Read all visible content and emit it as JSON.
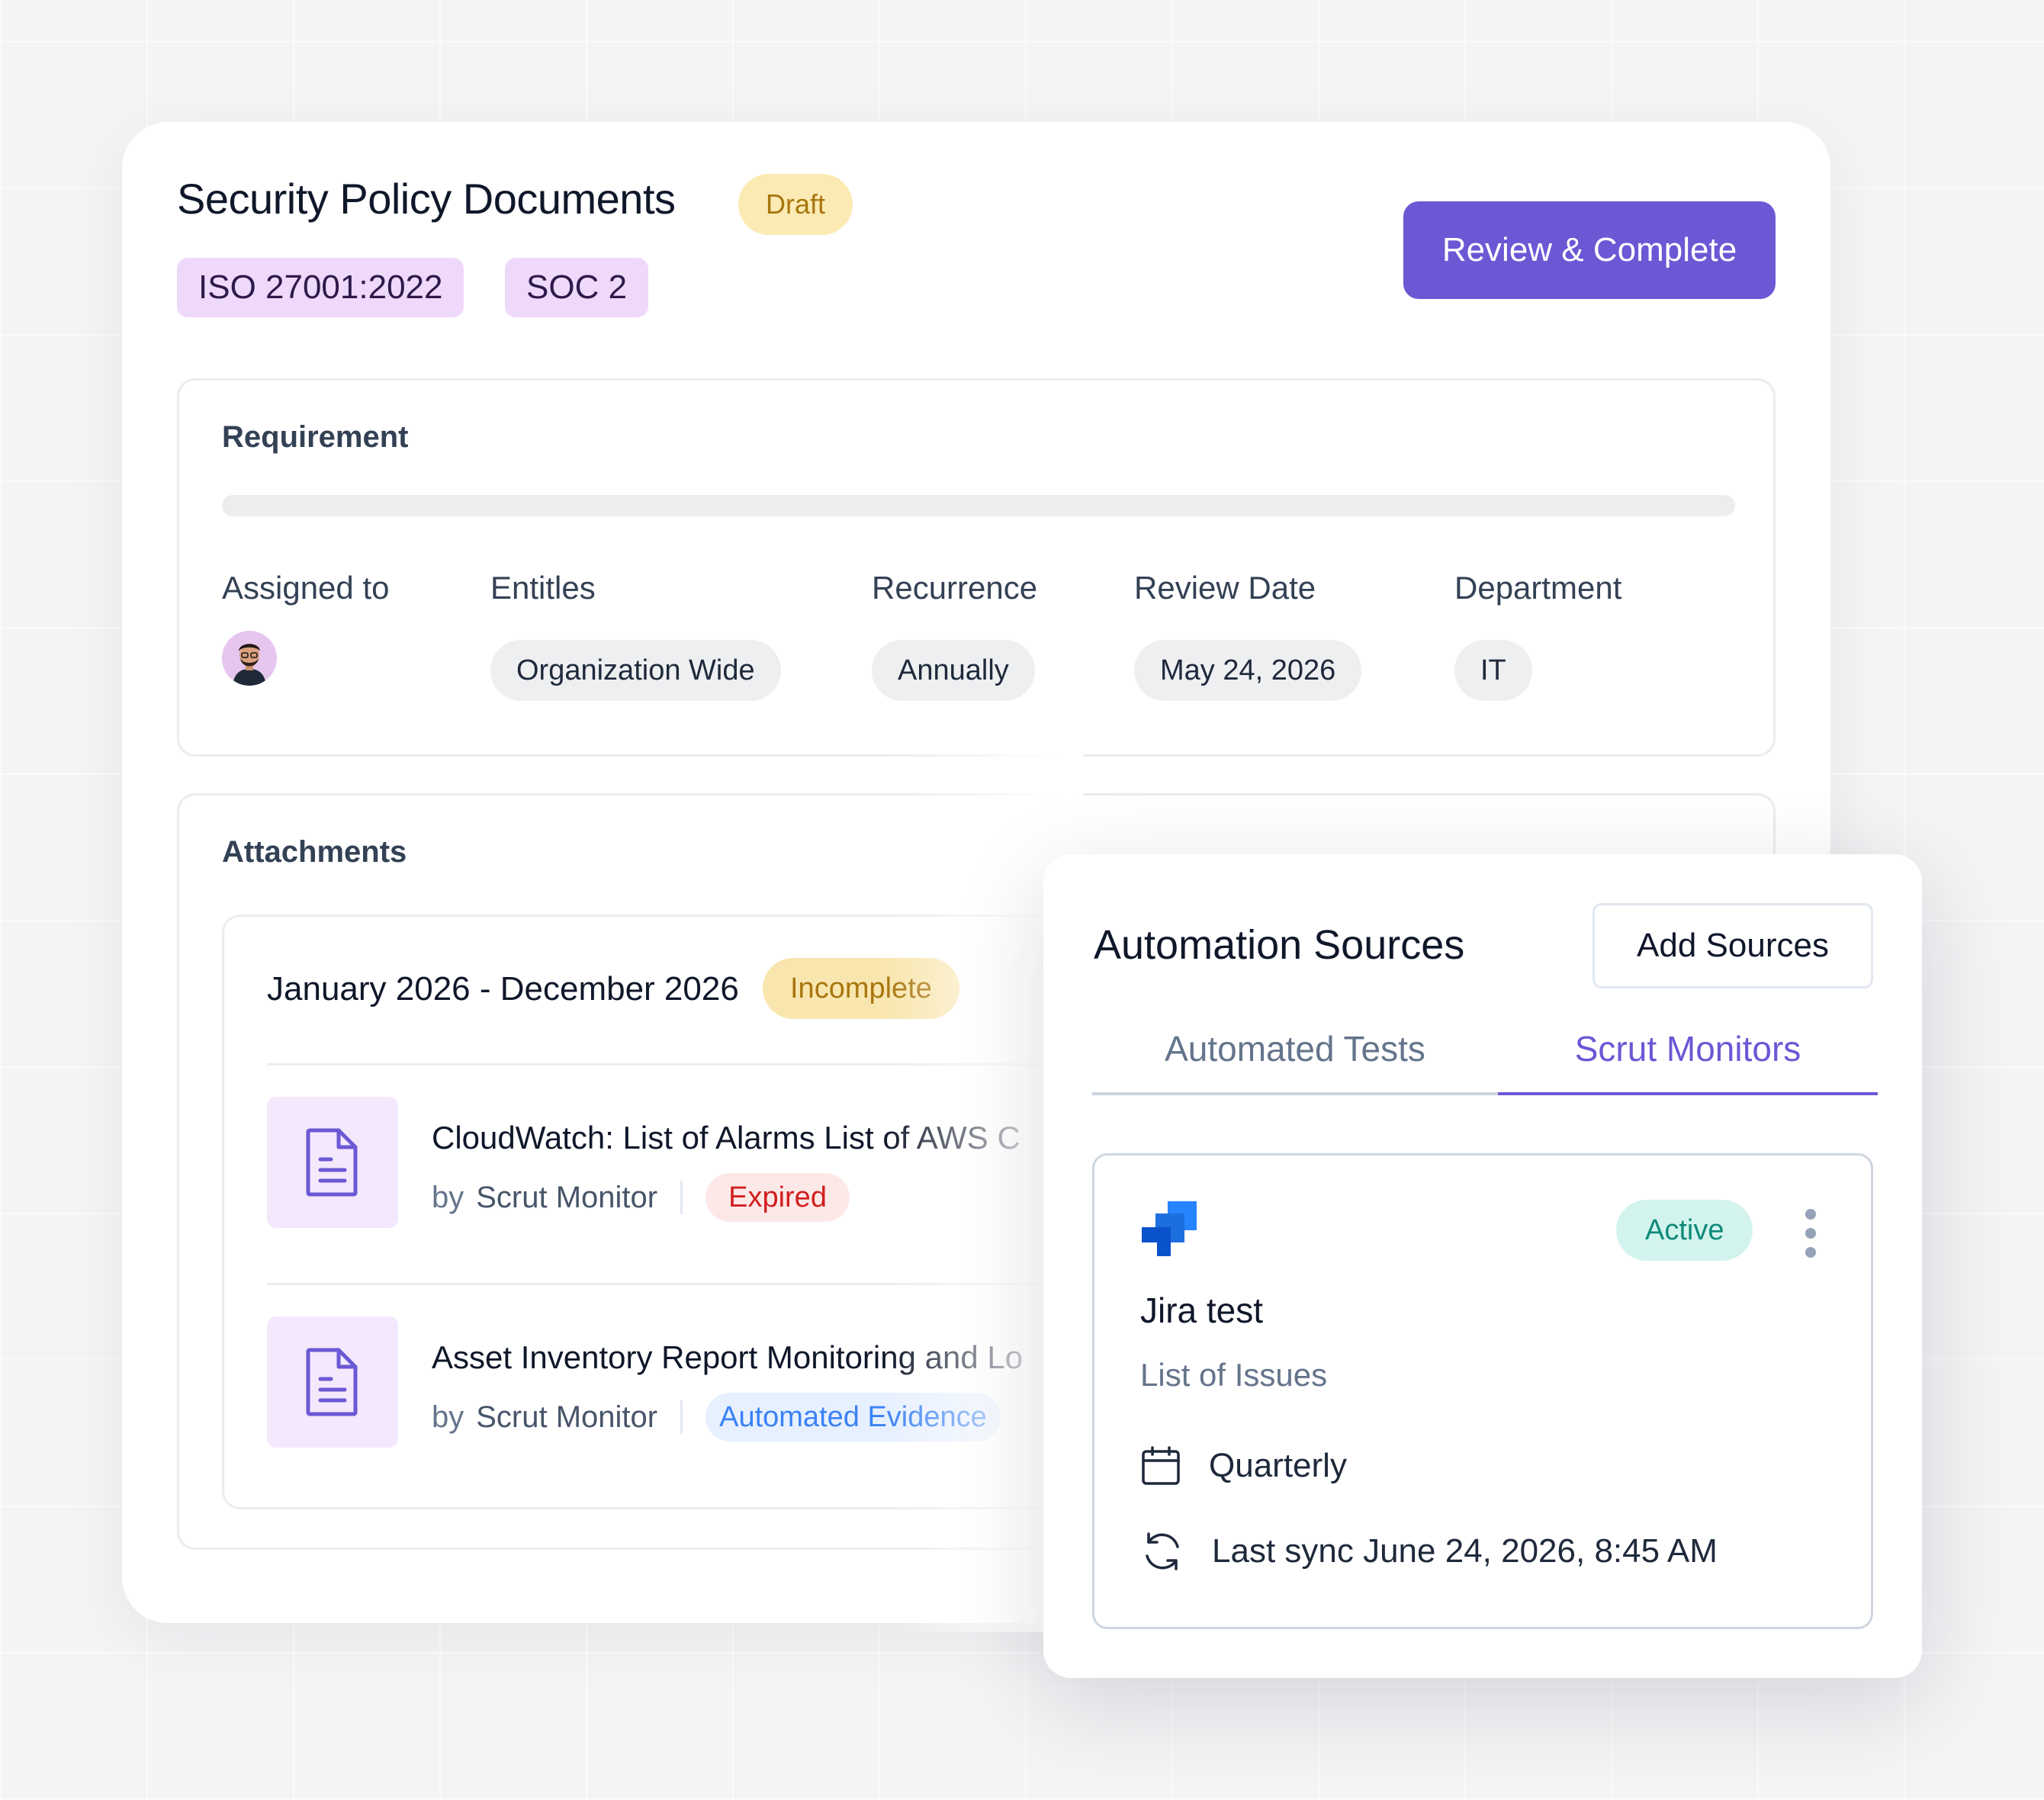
{
  "header": {
    "title": "Security Policy Documents",
    "status": "Draft",
    "frameworks": [
      "ISO 27001:2022",
      "SOC 2"
    ],
    "primary_action": "Review & Complete"
  },
  "requirement": {
    "label": "Requirement",
    "fields": {
      "assigned_to": "Assigned to",
      "entitles": "Entitles",
      "recurrence": "Recurrence",
      "review_date": "Review Date",
      "department": "Department"
    },
    "values": {
      "entitles": "Organization Wide",
      "recurrence": "Annually",
      "review_date": "May 24, 2026",
      "department": "IT"
    }
  },
  "attachments": {
    "label": "Attachments",
    "period": "January 2026 - December 2026",
    "period_status": "Incomplete",
    "items": [
      {
        "title": "CloudWatch: List of Alarms List of AWS C",
        "by": "by",
        "author": "Scrut Monitor",
        "badge": "Expired"
      },
      {
        "title": "Asset Inventory Report Monitoring and Lo",
        "by": "by",
        "author": "Scrut Monitor",
        "badge": "Automated Evidence"
      }
    ]
  },
  "automation": {
    "title": "Automation Sources",
    "add_button": "Add Sources",
    "tabs": [
      {
        "label": "Automated Tests",
        "active": false
      },
      {
        "label": "Scrut Monitors",
        "active": true
      }
    ],
    "source": {
      "icon": "jira-icon",
      "status": "Active",
      "name": "Jira test",
      "description": "List of Issues",
      "frequency": "Quarterly",
      "last_sync": "Last sync June 24, 2026, 8:45 AM"
    }
  },
  "colors": {
    "accent": "#6a58d5",
    "draft_bg": "#fbeab3",
    "expired": "#d11f1f",
    "active": "#0f8a7a"
  }
}
